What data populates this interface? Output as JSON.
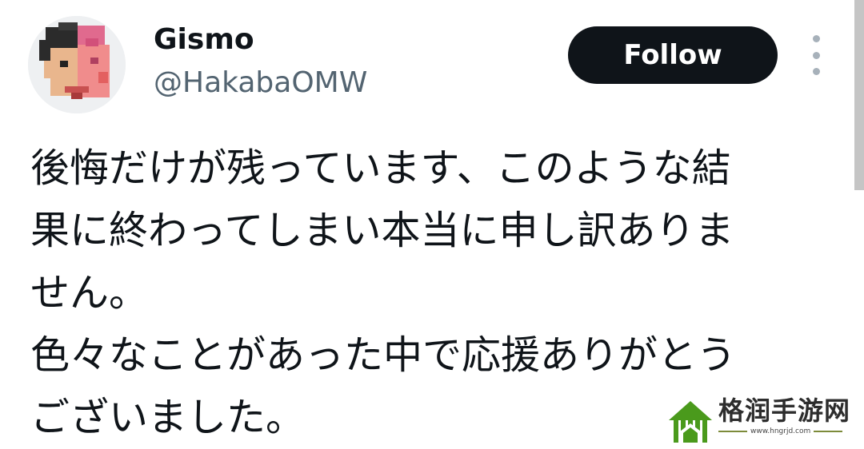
{
  "tweet": {
    "author": {
      "display_name": "Gismo",
      "handle": "@HakabaOMW",
      "avatar_icon": "pixel-art-avatar-icon"
    },
    "follow_label": "Follow",
    "more_icon": "more-vertical-icon",
    "text_lines": [
      "後悔だけが残っています、このような結",
      "果に終わってしまい本当に申し訳ありま",
      "せん。",
      "色々なことがあった中で応援ありがとう",
      "ございました。"
    ]
  },
  "watermark": {
    "title": "格润手游网",
    "url": "www.hngrjd.com",
    "logo_icon": "green-house-logo-icon",
    "accent_color": "#4a9a1c"
  },
  "colors": {
    "follow_bg": "#0f1419",
    "handle": "#536471",
    "text": "#0f1419"
  }
}
